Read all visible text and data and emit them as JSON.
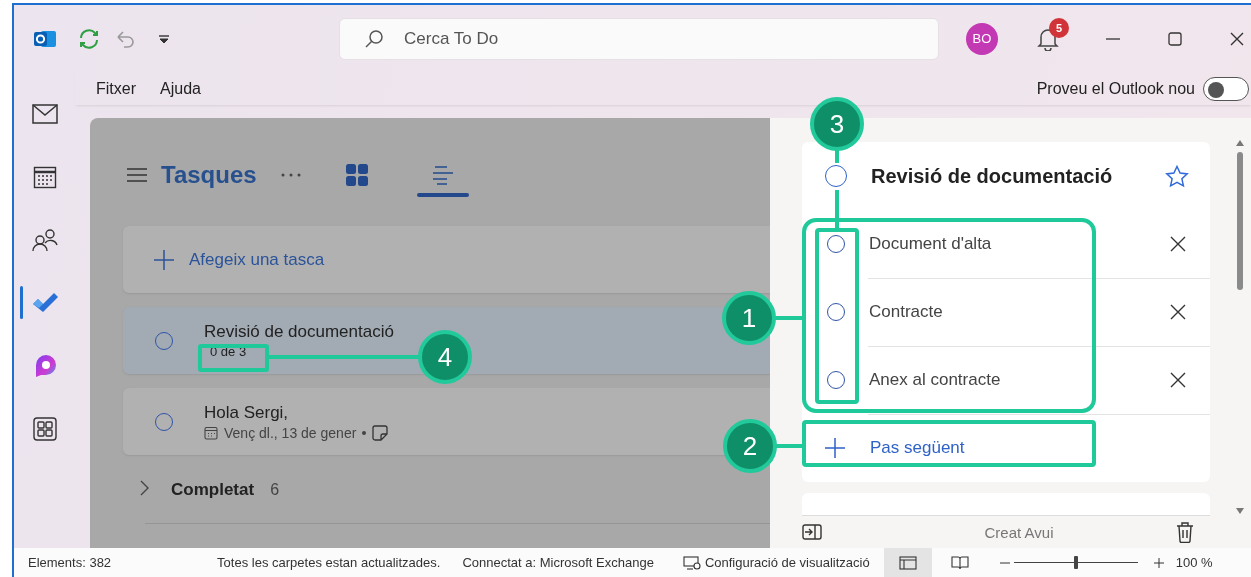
{
  "title_bar": {
    "search": {
      "placeholder": "Cerca To Do"
    },
    "avatar": "BO",
    "notifications": "5"
  },
  "menu": [
    {
      "label": "Fitxer"
    },
    {
      "label": "Ajuda"
    }
  ],
  "try_new": {
    "label": "Proveu el Outlook nou",
    "on": false
  },
  "nav": {
    "items": [
      {
        "kind": "mail",
        "selected": false
      },
      {
        "kind": "calendar",
        "selected": false
      },
      {
        "kind": "people",
        "selected": false
      },
      {
        "kind": "todo",
        "selected": true
      },
      {
        "kind": "copilot",
        "selected": false
      },
      {
        "kind": "apps",
        "selected": false
      }
    ]
  },
  "list": {
    "title": "Tasques",
    "views": [
      {
        "kind": "grid",
        "selected": false
      },
      {
        "kind": "list",
        "selected": true
      }
    ],
    "add_task": "Afegeix una tasca",
    "tasks": [
      {
        "title": "Revisió de documentació",
        "progress": "0 de 3",
        "completed": false,
        "selected": true
      },
      {
        "title": "Hola Sergi,",
        "due": "Venç dl., 13 de gener",
        "completed": false,
        "selected": false
      }
    ],
    "completed_group": {
      "label": "Completat",
      "count": "6",
      "expanded": false
    }
  },
  "detail": {
    "title": "Revisió de documentació",
    "completed": false,
    "important": false,
    "steps": [
      {
        "label": "Document d'alta",
        "completed": false
      },
      {
        "label": "Contracte",
        "completed": false
      },
      {
        "label": "Anex al contracte",
        "completed": false
      }
    ],
    "add_step": "Pas següent",
    "created": "Creat Avui"
  },
  "status_bar": {
    "items": "Elements: 382",
    "sync": "Totes les carpetes estan actualitzades.",
    "connection": "Connectat a: Microsoft Exchange",
    "view_settings": "Configuració de visualització",
    "zoom": {
      "level": 0.5,
      "reading": "100 %"
    }
  },
  "callouts": [
    {
      "number": "1"
    },
    {
      "number": "2"
    },
    {
      "number": "3"
    },
    {
      "number": "4"
    }
  ]
}
